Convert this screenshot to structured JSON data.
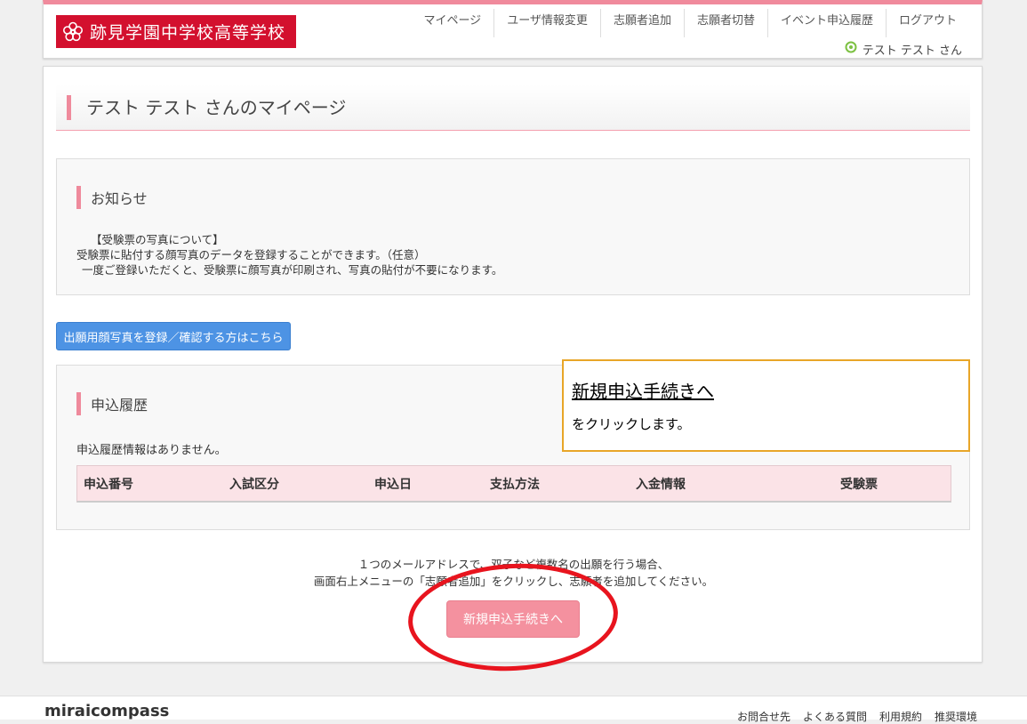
{
  "header": {
    "logo_text": "跡見学園中学校高等学校",
    "nav": [
      "マイページ",
      "ユーザ情報変更",
      "志願者追加",
      "志願者切替",
      "イベント申込履歴",
      "ログアウト"
    ],
    "user_label": "テスト テスト さん"
  },
  "main": {
    "page_title": "テスト テスト さんのマイページ",
    "notice": {
      "heading": "お知らせ",
      "line1": "【受験票の写真について】",
      "line2": "受験票に貼付する顔写真のデータを登録することができます。（任意）",
      "line3": "一度ご登録いただくと、受験票に顔写真が印刷され、写真の貼付が不要になります。"
    },
    "photo_button": "出願用顔写真を登録／確認する方はこちら",
    "history": {
      "heading": "申込履歴",
      "empty": "申込履歴情報はありません。",
      "columns": [
        "申込番号",
        "入試区分",
        "申込日",
        "支払方法",
        "入金情報",
        "受験票"
      ]
    },
    "note_line1": "１つのメールアドレスで、双子など複数名の出願を行う場合、",
    "note_line2": "画面右上メニューの「志願者追加」をクリックし、志願者を追加してください。",
    "new_button": "新規申込手続きへ"
  },
  "callout": {
    "title": "新規申込手続きへ",
    "text": "をクリックします。"
  },
  "footer": {
    "logo": "miraicompass",
    "links": [
      "お問合せ先",
      "よくある質問",
      "利用規約",
      "推奨環境"
    ]
  },
  "colors": {
    "accent_pink": "#ef8a9c",
    "logo_red": "#d3102e",
    "button_blue": "#4d93e4",
    "callout_border": "#e8a628",
    "ring_red": "#e8141e"
  }
}
